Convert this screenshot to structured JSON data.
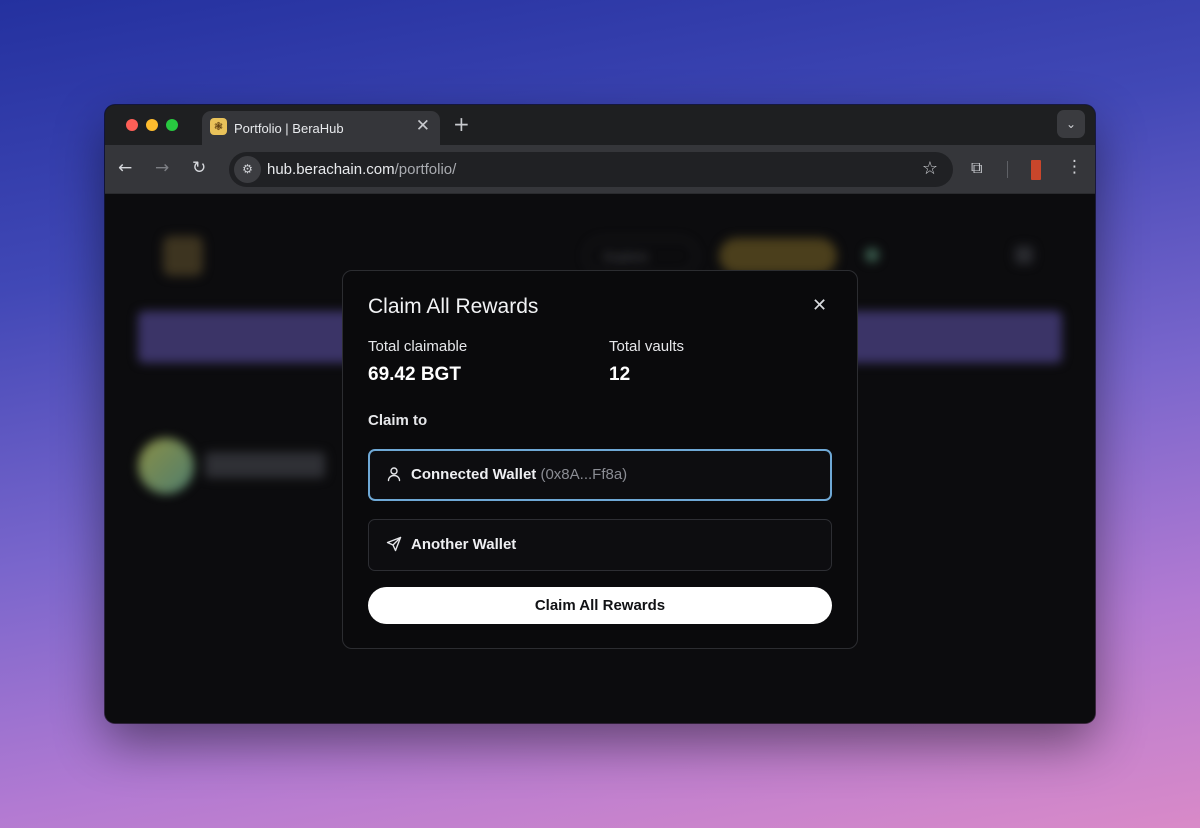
{
  "browser": {
    "tab_title": "Portfolio | BeraHub",
    "favicon_glyph": "❃",
    "close_glyph": "✕",
    "new_tab_glyph": "+",
    "tab_menu_glyph": "⌄",
    "url_host": "hub.berachain.com",
    "url_path": "/portfolio/",
    "icons": [
      "back-icon",
      "forward-icon",
      "reload-icon",
      "site-info-icon",
      "star-icon",
      "extensions-icon",
      "kebab-menu-icon"
    ]
  },
  "background_page": {
    "explore_label": "Explore",
    "accent_color": "#3b3467"
  },
  "modal": {
    "title": "Claim All Rewards",
    "close_glyph": "✕",
    "stats": {
      "claimable_label": "Total claimable",
      "claimable_value": "69.42 BGT",
      "vaults_label": "Total vaults",
      "vaults_value": "12"
    },
    "claim_to_label": "Claim to",
    "options": {
      "connected_label": "Connected Wallet",
      "connected_address": "(0x8A...Ff8a)",
      "another_label": "Another Wallet"
    },
    "submit_label": "Claim All Rewards",
    "selected_border_color": "#6fa9d6"
  }
}
